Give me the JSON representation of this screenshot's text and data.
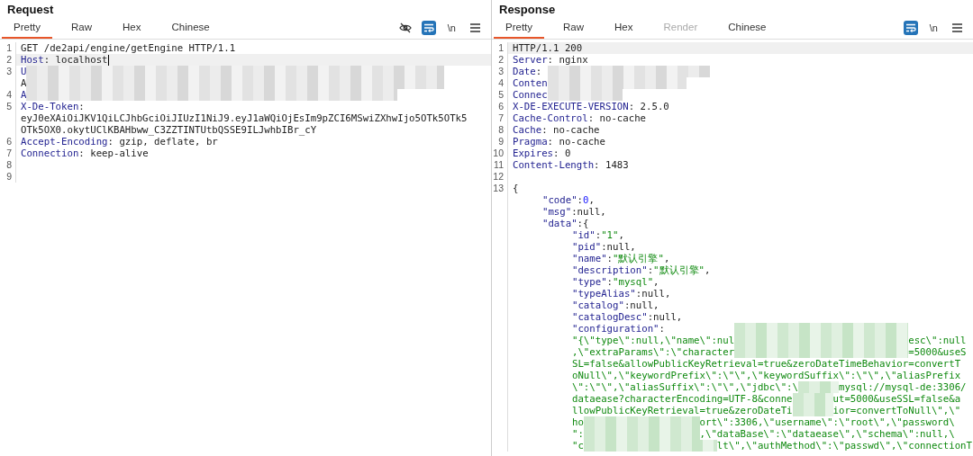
{
  "panes": [
    {
      "title": "Request",
      "tabs": [
        {
          "label": "Pretty",
          "selected": true,
          "disabled": false
        },
        {
          "label": "Raw",
          "selected": false,
          "disabled": false
        },
        {
          "label": "Hex",
          "selected": false,
          "disabled": false
        },
        {
          "label": "Chinese",
          "selected": false,
          "disabled": false
        }
      ],
      "tools": [
        {
          "kind": "hide",
          "on": false
        },
        {
          "kind": "wrap",
          "on": true
        },
        {
          "kind": "newline",
          "label": "\\n",
          "on": false
        },
        {
          "kind": "menu",
          "on": false
        }
      ],
      "lines": [
        {
          "num": "1",
          "highlighted": false,
          "segments": [
            {
              "kind": "text",
              "text": "GET /de2api/engine/getEngine HTTP/1.1"
            }
          ]
        },
        {
          "num": "2",
          "highlighted": true,
          "segments": [
            {
              "kind": "key",
              "text": "Host"
            },
            {
              "kind": "text",
              "text": ": localhost"
            },
            {
              "kind": "cursor"
            }
          ]
        },
        {
          "num": "3",
          "highlighted": false,
          "segments": [
            {
              "kind": "key",
              "text": "U"
            },
            {
              "kind": "blur"
            }
          ]
        },
        {
          "highlighted": false,
          "segments": [
            {
              "kind": "text",
              "text": "A"
            },
            {
              "kind": "blur"
            }
          ]
        },
        {
          "num": "4",
          "highlighted": false,
          "segments": [
            {
              "kind": "key",
              "text": "A"
            },
            {
              "kind": "blur"
            }
          ]
        },
        {
          "num": "5",
          "highlighted": false,
          "segments": [
            {
              "kind": "key",
              "text": "X-De-Token"
            },
            {
              "kind": "text",
              "text": ":"
            }
          ]
        },
        {
          "highlighted": false,
          "segments": [
            {
              "kind": "text",
              "text": "eyJ0eXAiOiJKV1QiLCJhbGciOiJIUzI1NiJ9.eyJ1aWQiOjEsIm9pZCI6MSwiZXhwIjo5OTk5OTk5"
            }
          ]
        },
        {
          "highlighted": false,
          "segments": [
            {
              "kind": "text",
              "text": "OTk5OX0.okytUClKBAHbww_C3ZZTINTUtbQSSE9ILJwhbIBr_cY"
            }
          ]
        },
        {
          "num": "6",
          "highlighted": false,
          "segments": [
            {
              "kind": "key",
              "text": "Accept-Encoding"
            },
            {
              "kind": "text",
              "text": ": gzip, deflate, br"
            }
          ]
        },
        {
          "num": "7",
          "highlighted": false,
          "segments": [
            {
              "kind": "key",
              "text": "Connection"
            },
            {
              "kind": "text",
              "text": ": keep-alive"
            }
          ]
        },
        {
          "num": "8",
          "highlighted": false
        },
        {
          "num": "9",
          "highlighted": false
        }
      ]
    },
    {
      "title": "Response",
      "tabs": [
        {
          "label": "Pretty",
          "selected": true,
          "disabled": false
        },
        {
          "label": "Raw",
          "selected": false,
          "disabled": false
        },
        {
          "label": "Hex",
          "selected": false,
          "disabled": false
        },
        {
          "label": "Render",
          "selected": false,
          "disabled": true
        },
        {
          "label": "Chinese",
          "selected": false,
          "disabled": false
        }
      ],
      "tools": [
        {
          "kind": "wrap",
          "on": true
        },
        {
          "kind": "newline",
          "label": "\\n",
          "on": false
        },
        {
          "kind": "menu",
          "on": false
        }
      ],
      "lines": [
        {
          "num": "1",
          "highlighted": true,
          "segments": [
            {
              "kind": "text",
              "text": "HTTP/1.1 200"
            }
          ]
        },
        {
          "num": "2",
          "highlighted": false,
          "segments": [
            {
              "kind": "key",
              "text": "Server"
            },
            {
              "kind": "text",
              "text": ": nginx"
            }
          ]
        },
        {
          "num": "3",
          "highlighted": false,
          "segments": [
            {
              "kind": "key",
              "text": "Date"
            },
            {
              "kind": "text",
              "text": ":"
            },
            {
              "kind": "blur"
            }
          ]
        },
        {
          "num": "4",
          "highlighted": false,
          "segments": [
            {
              "kind": "key",
              "text": "Conten"
            },
            {
              "kind": "blur"
            }
          ]
        },
        {
          "num": "5",
          "highlighted": false,
          "segments": [
            {
              "kind": "key",
              "text": "Connec"
            },
            {
              "kind": "blur"
            }
          ]
        },
        {
          "num": "6",
          "highlighted": false,
          "segments": [
            {
              "kind": "key",
              "text": "X-DE-EXECUTE-VERSION"
            },
            {
              "kind": "text",
              "text": ": 2.5.0"
            }
          ]
        },
        {
          "num": "7",
          "highlighted": false,
          "segments": [
            {
              "kind": "key",
              "text": "Cache-Control"
            },
            {
              "kind": "text",
              "text": ": no-cache"
            }
          ]
        },
        {
          "num": "8",
          "highlighted": false,
          "segments": [
            {
              "kind": "key",
              "text": "Cache"
            },
            {
              "kind": "text",
              "text": ": no-cache"
            }
          ]
        },
        {
          "num": "9",
          "highlighted": false,
          "segments": [
            {
              "kind": "key",
              "text": "Pragma"
            },
            {
              "kind": "text",
              "text": ": no-cache"
            }
          ]
        },
        {
          "num": "10",
          "highlighted": false,
          "segments": [
            {
              "kind": "key",
              "text": "Expires"
            },
            {
              "kind": "text",
              "text": ": 0"
            }
          ]
        },
        {
          "num": "11",
          "highlighted": false,
          "segments": [
            {
              "kind": "key",
              "text": "Content-Length"
            },
            {
              "kind": "text",
              "text": ": 1483"
            }
          ]
        },
        {
          "num": "12",
          "highlighted": false
        },
        {
          "num": "13",
          "highlighted": false,
          "segments": [
            {
              "kind": "text",
              "text": "{"
            }
          ],
          "children": [
            {
              "highlighted": false,
              "segments": [
                {
                  "kind": "key",
                  "text": "\"code\""
                },
                {
                  "kind": "text",
                  "text": ":"
                },
                {
                  "kind": "num",
                  "text": "0"
                },
                {
                  "kind": "text",
                  "text": ","
                }
              ]
            },
            {
              "highlighted": false,
              "segments": [
                {
                  "kind": "key",
                  "text": "\"msg\""
                },
                {
                  "kind": "text",
                  "text": ":null,"
                }
              ]
            },
            {
              "highlighted": false,
              "segments": [
                {
                  "kind": "key",
                  "text": "\"data\""
                },
                {
                  "kind": "text",
                  "text": ":{"
                }
              ],
              "children": [
                {
                  "highlighted": false,
                  "segments": [
                    {
                      "kind": "key",
                      "text": "\"id\""
                    },
                    {
                      "kind": "text",
                      "text": ":"
                    },
                    {
                      "kind": "str",
                      "text": "\"1\""
                    },
                    {
                      "kind": "text",
                      "text": ","
                    }
                  ]
                },
                {
                  "highlighted": false,
                  "segments": [
                    {
                      "kind": "key",
                      "text": "\"pid\""
                    },
                    {
                      "kind": "text",
                      "text": ":null,"
                    }
                  ]
                },
                {
                  "highlighted": false,
                  "segments": [
                    {
                      "kind": "key",
                      "text": "\"name\""
                    },
                    {
                      "kind": "text",
                      "text": ":"
                    },
                    {
                      "kind": "str",
                      "text": "\"默认引擎\""
                    },
                    {
                      "kind": "text",
                      "text": ","
                    }
                  ]
                },
                {
                  "highlighted": false,
                  "segments": [
                    {
                      "kind": "key",
                      "text": "\"description\""
                    },
                    {
                      "kind": "text",
                      "text": ":"
                    },
                    {
                      "kind": "str",
                      "text": "\"默认引擎\""
                    },
                    {
                      "kind": "text",
                      "text": ","
                    }
                  ]
                },
                {
                  "highlighted": false,
                  "segments": [
                    {
                      "kind": "key",
                      "text": "\"type\""
                    },
                    {
                      "kind": "text",
                      "text": ":"
                    },
                    {
                      "kind": "str",
                      "text": "\"mysql\""
                    },
                    {
                      "kind": "text",
                      "text": ","
                    }
                  ]
                },
                {
                  "highlighted": false,
                  "segments": [
                    {
                      "kind": "key",
                      "text": "\"typeAlias\""
                    },
                    {
                      "kind": "text",
                      "text": ":null,"
                    }
                  ]
                },
                {
                  "highlighted": false,
                  "segments": [
                    {
                      "kind": "key",
                      "text": "\"catalog\""
                    },
                    {
                      "kind": "text",
                      "text": ":null,"
                    }
                  ]
                },
                {
                  "highlighted": false,
                  "segments": [
                    {
                      "kind": "key",
                      "text": "\"catalogDesc\""
                    },
                    {
                      "kind": "text",
                      "text": ":null,"
                    }
                  ]
                },
                {
                  "highlighted": false,
                  "segments": [
                    {
                      "kind": "key",
                      "text": "\"configuration\""
                    },
                    {
                      "kind": "text",
                      "text": ":"
                    },
                    {
                      "kind": "blur"
                    }
                  ]
                },
                {
                  "highlighted": false,
                  "segments": [
                    {
                      "kind": "str",
                      "text": "\"{\\\"type\\\":null,\\\"name\\\":nul"
                    },
                    {
                      "kind": "blur"
                    },
                    {
                      "kind": "str",
                      "text": "esc\\\":null"
                    }
                  ]
                },
                {
                  "highlighted": false,
                  "segments": [
                    {
                      "kind": "str",
                      "text": ",\\\"extraParams\\\":\\\"character"
                    },
                    {
                      "kind": "blur"
                    },
                    {
                      "kind": "str",
                      "text": "=5000&useS"
                    }
                  ]
                },
                {
                  "highlighted": false,
                  "segments": [
                    {
                      "kind": "str",
                      "text": "SL=false&allowPublicKeyRetrieval=true&zeroDateTimeBehavior=convertT"
                    }
                  ]
                },
                {
                  "highlighted": false,
                  "segments": [
                    {
                      "kind": "str",
                      "text": "oNull\\\",\\\"keywordPrefix\\\":\\\"\\\",\\\"keywordSuffix\\\":\\\"\\\",\\\"aliasPrefix"
                    }
                  ]
                },
                {
                  "highlighted": false,
                  "segments": [
                    {
                      "kind": "str",
                      "text": "\\\":\\\"\\\",\\\"aliasSuffix\\\":\\\"\\\",\\\"jdbc\\\":\\"
                    },
                    {
                      "kind": "blur"
                    },
                    {
                      "kind": "str",
                      "text": "mysql://mysql-de:3306/"
                    }
                  ]
                },
                {
                  "highlighted": false,
                  "segments": [
                    {
                      "kind": "str",
                      "text": "dataease?characterEncoding=UTF-8&conne"
                    },
                    {
                      "kind": "blur"
                    },
                    {
                      "kind": "str",
                      "text": "ut=5000&useSSL=false&a"
                    }
                  ]
                },
                {
                  "highlighted": false,
                  "segments": [
                    {
                      "kind": "str",
                      "text": "llowPublicKeyRetrieval=true&zeroDateTi"
                    },
                    {
                      "kind": "blur"
                    },
                    {
                      "kind": "str",
                      "text": "ior=convertToNull\\\",\\\""
                    }
                  ]
                },
                {
                  "highlighted": false,
                  "segments": [
                    {
                      "kind": "str",
                      "text": "ho"
                    },
                    {
                      "kind": "blur"
                    },
                    {
                      "kind": "str",
                      "text": "ort\\\":3306,\\\"username\\\":\\\"root\\\",\\\"password\\"
                    }
                  ]
                },
                {
                  "highlighted": false,
                  "segments": [
                    {
                      "kind": "str",
                      "text": "\":"
                    },
                    {
                      "kind": "blur"
                    },
                    {
                      "kind": "str",
                      "text": ",\\\"dataBase\\\":\\\"dataease\\\",\\\"schema\\\":null,\\"
                    }
                  ]
                },
                {
                  "highlighted": false,
                  "segments": [
                    {
                      "kind": "str",
                      "text": "\"c"
                    },
                    {
                      "kind": "blur"
                    },
                    {
                      "kind": "str",
                      "text": "lt\\\",\\\"authMethod\\\":\\\"passwd\\\",\\\"connectionT"
                    }
                  ]
                }
              ]
            }
          ]
        }
      ]
    }
  ]
}
